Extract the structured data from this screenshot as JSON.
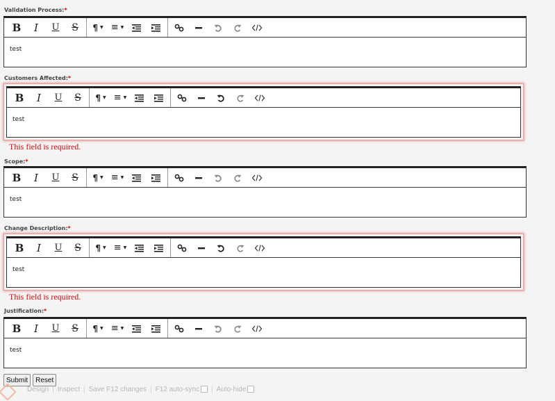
{
  "fields": [
    {
      "label": "Validation Process:",
      "required_mark": "*",
      "value": "test",
      "invalid": false,
      "error": ""
    },
    {
      "label": "Customers Affected:",
      "required_mark": "*",
      "value": "test",
      "invalid": true,
      "error": "This field is required."
    },
    {
      "label": "Scope:",
      "required_mark": "*",
      "value": "test",
      "invalid": false,
      "error": ""
    },
    {
      "label": "Change Description:",
      "required_mark": "*",
      "value": "test",
      "invalid": true,
      "error": "This field is required."
    },
    {
      "label": "Justification:",
      "required_mark": "*",
      "value": "test",
      "invalid": false,
      "error": ""
    }
  ],
  "toolbar": {
    "bold": "B",
    "italic": "I",
    "underline": "U",
    "strike": "S",
    "paragraph": "¶",
    "align": "≡",
    "icons": [
      "bold-icon",
      "italic-icon",
      "underline-icon",
      "strikethrough-icon",
      "paragraph-icon",
      "align-icon",
      "outdent-icon",
      "indent-icon",
      "link-icon",
      "horizontal-rule-icon",
      "undo-icon",
      "redo-icon",
      "code-icon"
    ]
  },
  "buttons": {
    "submit": "Submit",
    "reset": "Reset"
  },
  "devbar": {
    "design": "Design",
    "inspect": "Inspect",
    "save": "Save F12 changes",
    "autosync": "F12 auto-sync",
    "autohide": "Auto-hide"
  },
  "colors": {
    "error": "#e00000",
    "required": "#cc0000",
    "invalid_glow": "#e85050"
  }
}
